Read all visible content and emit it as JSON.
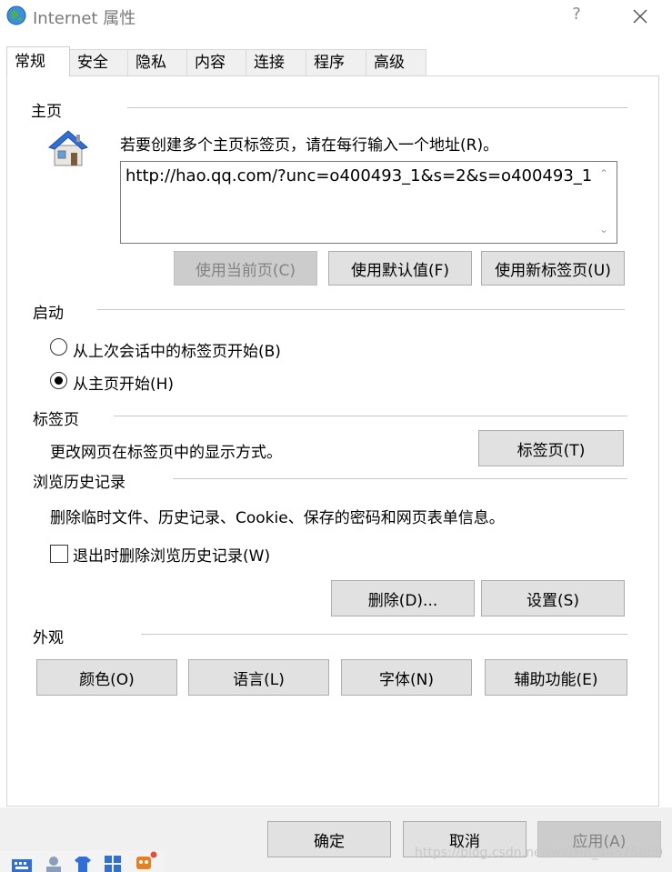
{
  "window": {
    "title": "Internet 属性",
    "help": "?"
  },
  "tabs": [
    {
      "label": "常规",
      "active": true
    },
    {
      "label": "安全"
    },
    {
      "label": "隐私"
    },
    {
      "label": "内容"
    },
    {
      "label": "连接"
    },
    {
      "label": "程序"
    },
    {
      "label": "高级"
    }
  ],
  "home": {
    "section_title": "主页",
    "instruction": "若要创建多个主页标签页，请在每行输入一个地址(R)。",
    "url_value": "http://hao.qq.com/?unc=o400493_1&s=2&s=o400493_1",
    "buttons": {
      "use_current": "使用当前页(C)",
      "use_default": "使用默认值(F)",
      "use_new_tab": "使用新标签页(U)"
    }
  },
  "startup": {
    "section_title": "启动",
    "option_last_session": "从上次会话中的标签页开始(B)",
    "option_home": "从主页开始(H)",
    "selected": "home"
  },
  "tabs_section": {
    "section_title": "标签页",
    "description": "更改网页在标签页中的显示方式。",
    "button": "标签页(T)"
  },
  "history": {
    "section_title": "浏览历史记录",
    "description": "删除临时文件、历史记录、Cookie、保存的密码和网页表单信息。",
    "checkbox_label": "退出时删除浏览历史记录(W)",
    "checked": false,
    "delete_button": "删除(D)...",
    "settings_button": "设置(S)"
  },
  "appearance": {
    "section_title": "外观",
    "colors_button": "颜色(O)",
    "languages_button": "语言(L)",
    "fonts_button": "字体(N)",
    "accessibility_button": "辅助功能(E)"
  },
  "footer": {
    "ok": "确定",
    "cancel": "取消",
    "apply": "应用(A)"
  },
  "watermark": "https://blog.csdn.net/weixin_44575660",
  "colors": {
    "accent_house_roof": "#2f6fd6",
    "disabled_button": "#cccccc",
    "button_face": "#e1e1e1"
  }
}
